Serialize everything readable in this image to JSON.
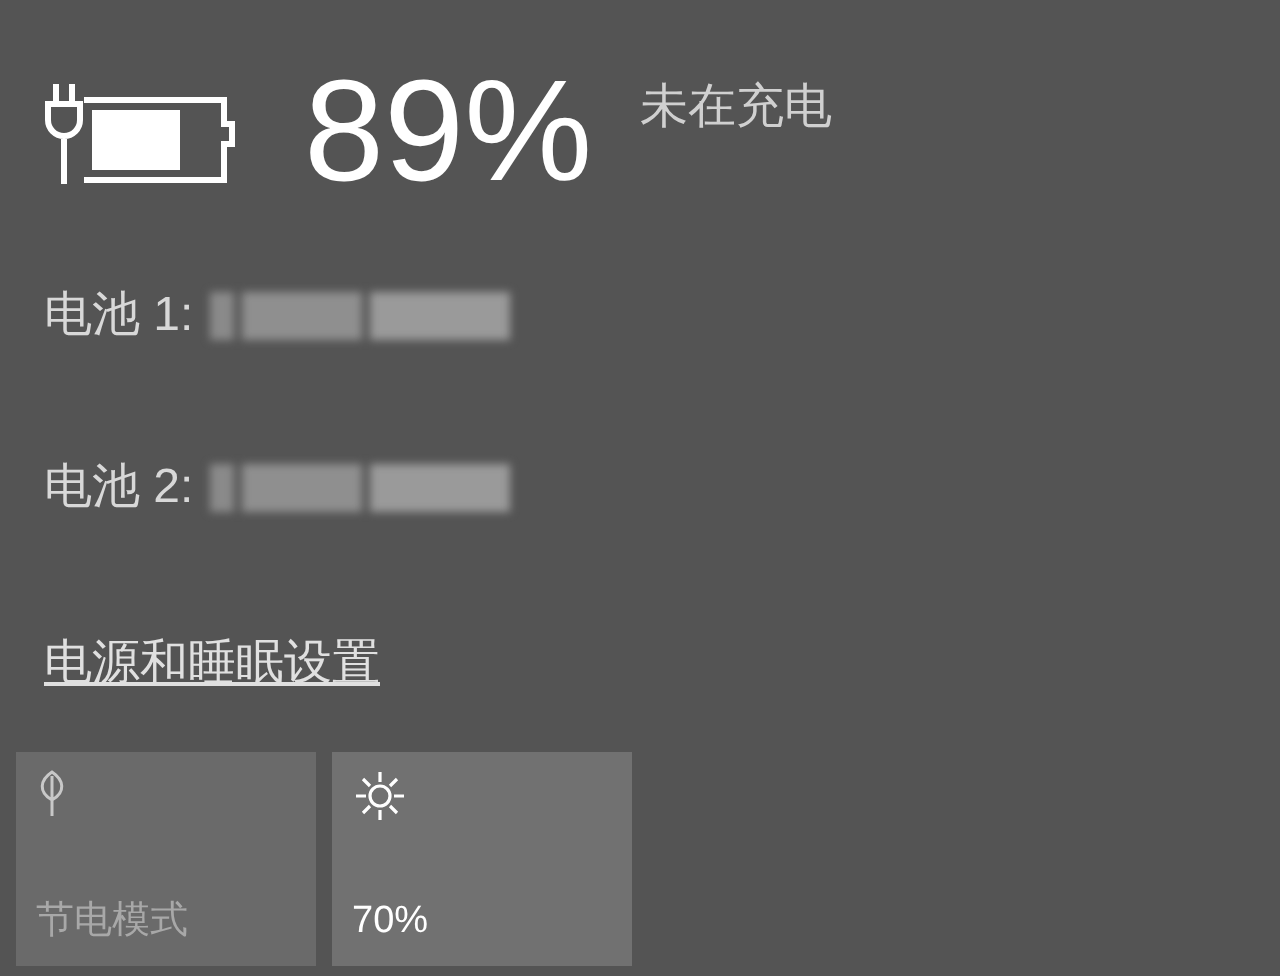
{
  "battery": {
    "percent": "89%",
    "status": "未在充电"
  },
  "batteries": [
    {
      "label": "电池 1:"
    },
    {
      "label": "电池 2:"
    }
  ],
  "settings_link": "电源和睡眠设置",
  "tiles": [
    {
      "kind": "saver",
      "label": "节电模式",
      "disabled": true
    },
    {
      "kind": "brightness",
      "label": "70%",
      "disabled": false
    }
  ]
}
